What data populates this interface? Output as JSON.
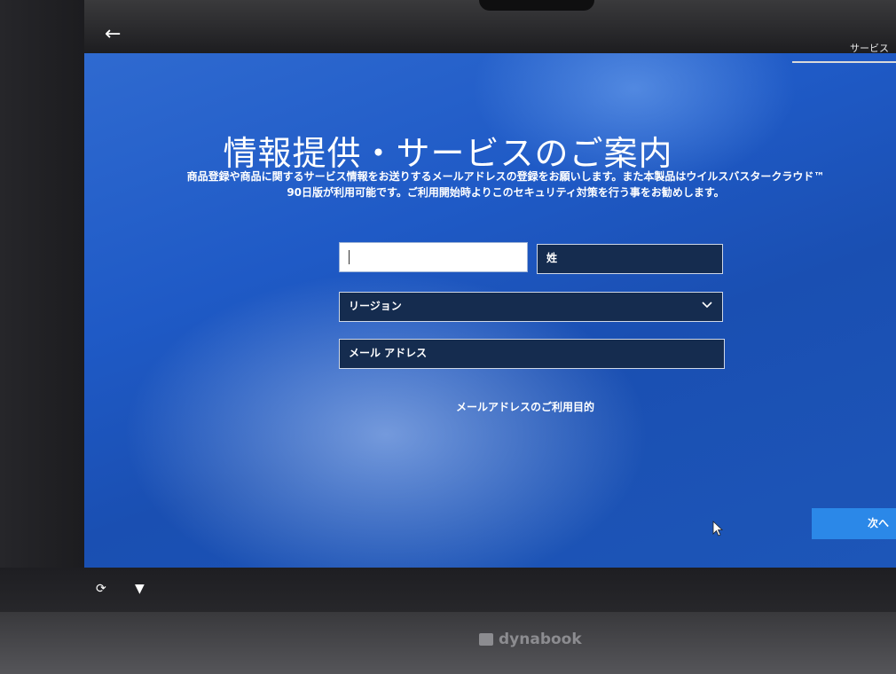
{
  "header": {
    "back_icon": "arrow-left-icon",
    "tab_label": "サービス"
  },
  "main": {
    "title": "情報提供・サービスのご案内",
    "description_line1": "商品登録や商品に関するサービス情報をお送りするメールアドレスの登録をお願いします。また本製品はウイルスバスタークラウド™",
    "description_line2": "90日版が利用可能です。ご利用開始時よりこのセキュリティ対策を行う事をお勧めします。",
    "form": {
      "first_name": {
        "value": "",
        "placeholder": ""
      },
      "last_name": {
        "value": "",
        "placeholder": "姓"
      },
      "region": {
        "selected": "リージョン"
      },
      "email": {
        "value": "",
        "placeholder": "メール アドレス"
      }
    },
    "email_purpose_link": "メールアドレスのご利用目的",
    "next_button": "次へ"
  },
  "footer": {
    "accessibility_icon": "ease-of-access-icon",
    "microphone_icon": "microphone-icon",
    "brand": "dynabook"
  },
  "colors": {
    "screen_blue": "#1f5ac6",
    "button_blue": "#2b88e8",
    "field_bg": "#152c4f"
  }
}
